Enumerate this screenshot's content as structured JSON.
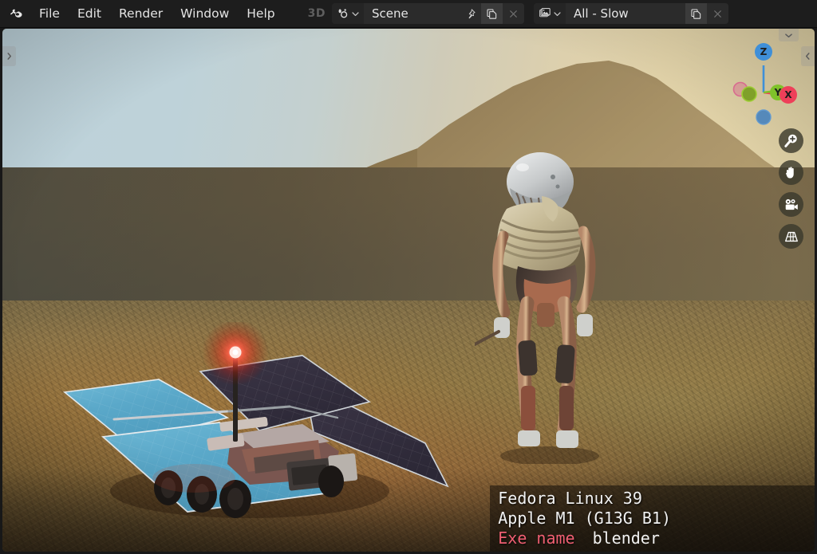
{
  "app": {
    "name": "blender",
    "logo_icon": "blender-logo-icon"
  },
  "topbar": {
    "menus": [
      {
        "label": "File"
      },
      {
        "label": "Edit"
      },
      {
        "label": "Render"
      },
      {
        "label": "Window"
      },
      {
        "label": "Help"
      }
    ],
    "mode_label": "3D",
    "scene_selector": {
      "icon": "scene-data-icon",
      "dropdown_icon": "chevron-down-icon",
      "value": "Scene",
      "pin_icon": "pin-icon",
      "new_icon": "duplicate-icon",
      "unlink_icon": "close-x-icon"
    },
    "viewlayer_selector": {
      "icon": "view-layer-icon",
      "dropdown_icon": "chevron-down-icon",
      "value": "All - Slow",
      "new_icon": "duplicate-icon",
      "unlink_icon": "close-x-icon"
    }
  },
  "viewport": {
    "edge_arrows": {
      "left": "chevron-right-icon",
      "right": "chevron-left-icon",
      "top": "chevron-down-icon"
    },
    "gizmo": {
      "axes": [
        {
          "label": "Z",
          "color": "#3f8fd8",
          "filled": true
        },
        {
          "label": "Y",
          "color": "#7fc22a",
          "filled": true
        },
        {
          "label": "X",
          "color": "#ee3f59",
          "filled": true
        },
        {
          "label": "",
          "color": "#7fc22a",
          "filled": true
        },
        {
          "label": "",
          "color": "#d86b8f",
          "filled": false
        },
        {
          "label": "",
          "color": "#3f8fd8",
          "filled": true
        }
      ]
    },
    "tools": [
      {
        "name": "zoom-tool",
        "icon": "magnifier-plus-icon"
      },
      {
        "name": "pan-tool",
        "icon": "hand-icon"
      },
      {
        "name": "camera-view-tool",
        "icon": "camera-icon"
      },
      {
        "name": "toggle-perspective-tool",
        "icon": "grid-perspective-icon"
      }
    ],
    "scene_objects": {
      "rover": "mars-rover-solar-panels",
      "robot": "humanoid-android-figure",
      "terrain": "rocky-martian-landscape",
      "mesa": "distant-mesa-butte"
    }
  },
  "stats_overlay": {
    "line1": "Fedora Linux 39",
    "line2": "Apple M1 (G13G B1)",
    "exe_label": "Exe name",
    "exe_value": "blender"
  },
  "colors": {
    "topbar_bg": "#1d1d1d",
    "menu_text": "#e4e4e4",
    "accent_red": "#ef5f72",
    "axis_x": "#ee3f59",
    "axis_y": "#7fc22a",
    "axis_z": "#3f8fd8"
  }
}
